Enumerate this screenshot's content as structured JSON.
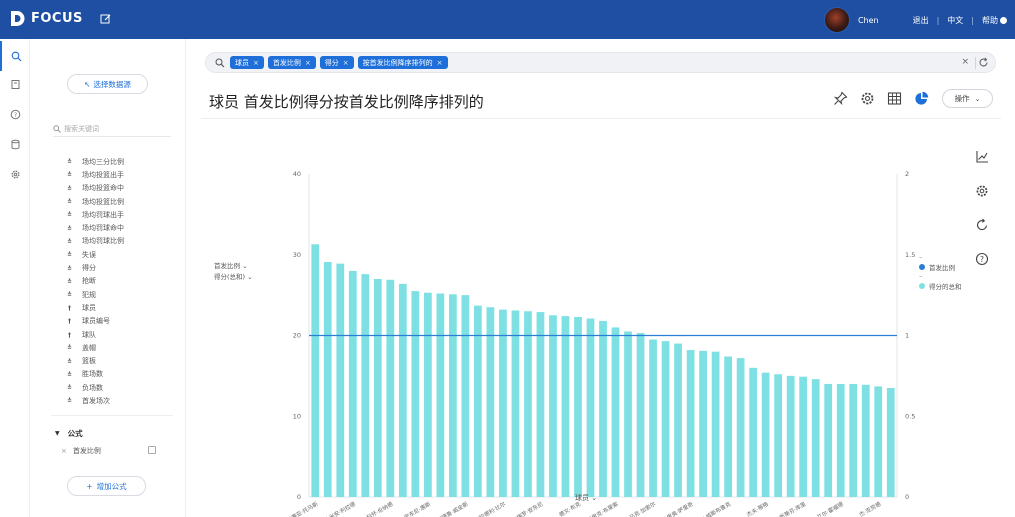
{
  "app": {
    "logo_text": "FOCUS"
  },
  "user": {
    "name": "Chen"
  },
  "topnav": {
    "logout": "退出",
    "lang": "中文",
    "help": "帮助"
  },
  "panel": {
    "select_source": "选择数据源",
    "search_placeholder": "搜索关键词",
    "fields": [
      {
        "label": "场均三分比例",
        "type": "measure"
      },
      {
        "label": "场均投篮出手",
        "type": "measure"
      },
      {
        "label": "场均投篮命中",
        "type": "measure"
      },
      {
        "label": "场均投篮比例",
        "type": "measure"
      },
      {
        "label": "场均罚球出手",
        "type": "measure"
      },
      {
        "label": "场均罚球命中",
        "type": "measure"
      },
      {
        "label": "场均罚球比例",
        "type": "measure"
      },
      {
        "label": "失误",
        "type": "measure"
      },
      {
        "label": "得分",
        "type": "measure"
      },
      {
        "label": "抢断",
        "type": "measure"
      },
      {
        "label": "犯规",
        "type": "measure"
      },
      {
        "label": "球员",
        "type": "dimension"
      },
      {
        "label": "球员编号",
        "type": "dimension"
      },
      {
        "label": "球队",
        "type": "dimension"
      },
      {
        "label": "盖帽",
        "type": "measure"
      },
      {
        "label": "篮板",
        "type": "measure"
      },
      {
        "label": "胜场数",
        "type": "measure"
      },
      {
        "label": "负场数",
        "type": "measure"
      },
      {
        "label": "首发场次",
        "type": "measure"
      }
    ],
    "formula_header": "公式",
    "formula_item": "首发比例",
    "add_formula": "增加公式"
  },
  "search": {
    "tokens": [
      "球员",
      "首发比例",
      "得分",
      "按首发比例降序排列的"
    ]
  },
  "page_title": "球员 首发比例得分按首发比例降序排列的",
  "toolbar": {
    "operate": "操作"
  },
  "chart_left_labels": {
    "line_measure": "首发比例",
    "bar_measure": "得分(总和)"
  },
  "colors": {
    "topbar": "#1e4fa3",
    "accent": "#1e6fd9",
    "bar": "#7ee0e3",
    "line": "#2a7fd4"
  },
  "chart_data": {
    "type": "bar",
    "xlabel": "球员",
    "ylim": [
      0,
      40
    ],
    "ylim_right": [
      0,
      2
    ],
    "left_ticks": [
      "0",
      "10",
      "20",
      "30",
      "40"
    ],
    "right_ticks": [
      "0",
      "0.5",
      "1",
      "1.5",
      "2"
    ],
    "x_tick_labels": [
      "以赛亚·托马斯",
      "达米安·利拉德",
      "科怀·伦纳德",
      "卡尔-安东尼·唐斯",
      "安德鲁·威金斯",
      "布拉德利·比尔",
      "卡梅罗·安东尼",
      "德文·布克",
      "埃里克·布莱索",
      "马克·加索尔",
      "达里奥·萨里奇",
      "拉塞尔·威斯布鲁克",
      "杰夫·蒂格",
      "斯蒂芬·库里",
      "艾尔·霍福德",
      "杰·克劳德"
    ],
    "series": [
      {
        "name": "得分的总和",
        "values": [
          31.3,
          29.1,
          28.9,
          28.0,
          27.6,
          27.0,
          26.9,
          26.4,
          25.5,
          25.3,
          25.2,
          25.1,
          25.0,
          23.7,
          23.5,
          23.2,
          23.1,
          23.0,
          22.9,
          22.5,
          22.4,
          22.3,
          22.1,
          21.8,
          21.0,
          20.5,
          20.3,
          19.5,
          19.3,
          19.0,
          18.2,
          18.1,
          18.0,
          17.4,
          17.2,
          16.0,
          15.4,
          15.2,
          15.0,
          14.9,
          14.6,
          14.0,
          14.0,
          14.0,
          13.9,
          13.7,
          13.5
        ]
      },
      {
        "name": "首发比例",
        "values": [
          1,
          1,
          1,
          1,
          1,
          1,
          1,
          1,
          1,
          1,
          1,
          1,
          1,
          1,
          1,
          1,
          1,
          1,
          1,
          1,
          1,
          1,
          1,
          1,
          1,
          1,
          1,
          1,
          1,
          1,
          1,
          1,
          1,
          1,
          1,
          1,
          1,
          1,
          1,
          1,
          1,
          1,
          1,
          1,
          1,
          1,
          1
        ]
      }
    ],
    "legend": [
      "首发比例",
      "得分的总和"
    ],
    "legend_position": "right"
  }
}
